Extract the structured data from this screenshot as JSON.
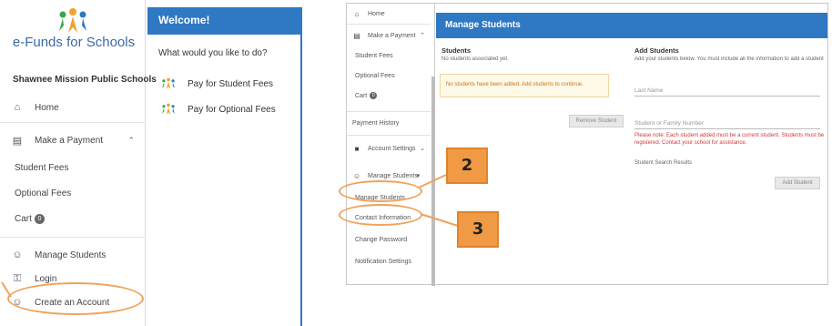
{
  "left_screenshot": {
    "brand": "e-Funds for Schools",
    "district": "Shawnee Mission Public Schools",
    "nav": {
      "home": "Home",
      "make_payment": "Make a Payment",
      "student_fees": "Student Fees",
      "optional_fees": "Optional Fees",
      "cart": "Cart",
      "cart_count": "0",
      "manage_students": "Manage Students",
      "login": "Login",
      "create_account": "Create an Account"
    },
    "welcome": {
      "title": "Welcome!",
      "question": "What would you like to do?",
      "pay_student_fees": "Pay for Student Fees",
      "pay_optional_fees": "Pay for Optional Fees"
    }
  },
  "right_screenshot": {
    "sidebar": {
      "home": "Home",
      "make_payment": "Make a Payment",
      "student_fees": "Student Fees",
      "optional_fees": "Optional Fees",
      "cart": "Cart",
      "cart_count": "0",
      "payment_history": "Payment History",
      "account_settings": "Account Settings",
      "manage_students": "Manage Students",
      "manage_students_sub": "Manage Students",
      "contact_information": "Contact Information",
      "change_password": "Change Password",
      "notification_settings": "Notification Settings"
    },
    "header": "Manage Students",
    "students": {
      "title": "Students",
      "subtitle": "No students associated yet.",
      "note": "No students have been added. Add students to continue.",
      "remove_button": "Remove Student"
    },
    "add_students": {
      "title": "Add Students",
      "subtitle": "Add your students below. You must include all the information to add a student.",
      "last_name_placeholder": "Last Name",
      "student_id_placeholder": "Student or Family Number",
      "warning": "Please note: Each student added must be a current student. Students must be registered. Contact your school for assistance.",
      "search_label": "Student Search Results",
      "add_button": "Add Student"
    }
  },
  "annotations": {
    "callout_2": "2",
    "callout_3": "3",
    "color": "#f09a45"
  },
  "colors": {
    "brand_blue": "#2f78c4",
    "warning_red": "#d23838",
    "note_orange": "#c7741d"
  }
}
